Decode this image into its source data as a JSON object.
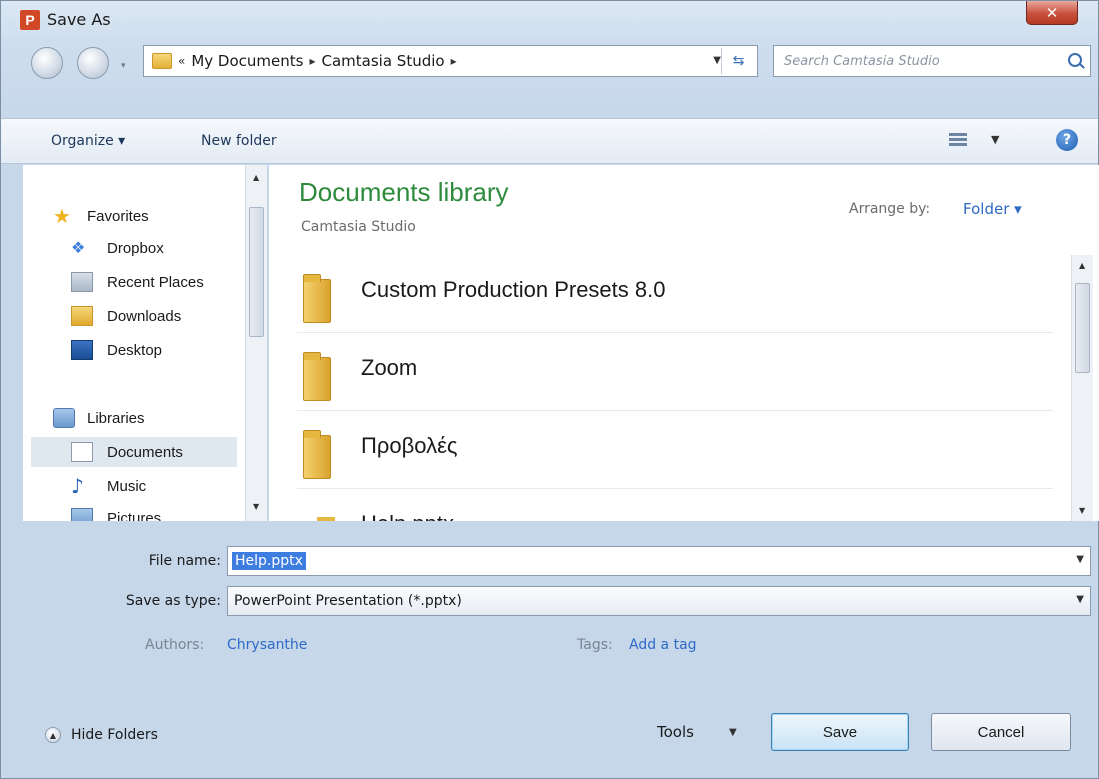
{
  "window": {
    "title": "Save As",
    "app_icon_letter": "P",
    "close_glyph": "✕"
  },
  "navigation": {
    "breadcrumb_prefix": "«",
    "breadcrumb": [
      "My Documents",
      "Camtasia Studio"
    ],
    "breadcrumb_separator": "▸",
    "search_placeholder": "Search Camtasia Studio"
  },
  "toolbar": {
    "organize_label": "Organize ▾",
    "new_folder_label": "New folder",
    "help_glyph": "?"
  },
  "sidebar": {
    "items": [
      {
        "label": "Favorites",
        "icon": "star-icon",
        "level": "top"
      },
      {
        "label": "Dropbox",
        "icon": "dropbox-icon",
        "level": "child"
      },
      {
        "label": "Recent Places",
        "icon": "recent-places-icon",
        "level": "child"
      },
      {
        "label": "Downloads",
        "icon": "downloads-folder-icon",
        "level": "child"
      },
      {
        "label": "Desktop",
        "icon": "desktop-icon",
        "level": "child"
      },
      {
        "label": "Libraries",
        "icon": "libraries-icon",
        "level": "top"
      },
      {
        "label": "Documents",
        "icon": "documents-icon",
        "level": "child",
        "selected": true
      },
      {
        "label": "Music",
        "icon": "music-icon",
        "level": "child"
      },
      {
        "label": "Pictures",
        "icon": "pictures-icon",
        "level": "child"
      }
    ]
  },
  "content": {
    "library_title": "Documents library",
    "library_subtitle": "Camtasia Studio",
    "arrange_by_label": "Arrange by:",
    "arrange_by_value": "Folder ▾",
    "files": [
      {
        "name": "Custom Production Presets 8.0",
        "type": "folder"
      },
      {
        "name": "Zoom",
        "type": "folder"
      },
      {
        "name": "Προβολές",
        "type": "folder"
      },
      {
        "name": "Help.pptx",
        "type": "pptx"
      }
    ]
  },
  "form": {
    "file_name_label": "File name:",
    "file_name_value": "Help.pptx",
    "save_type_label": "Save as type:",
    "save_type_value": "PowerPoint Presentation (*.pptx)",
    "authors_label": "Authors:",
    "authors_value": "Chrysanthe",
    "tags_label": "Tags:",
    "tags_value": "Add a tag"
  },
  "footer": {
    "hide_folders_label": "Hide Folders",
    "tools_label": "Tools",
    "save_label": "Save",
    "cancel_label": "Cancel"
  },
  "colors": {
    "library_title": "#2e8b3d",
    "link": "#2d6ac6",
    "selection": "#3d7de0",
    "close_button": "#c7503c"
  }
}
